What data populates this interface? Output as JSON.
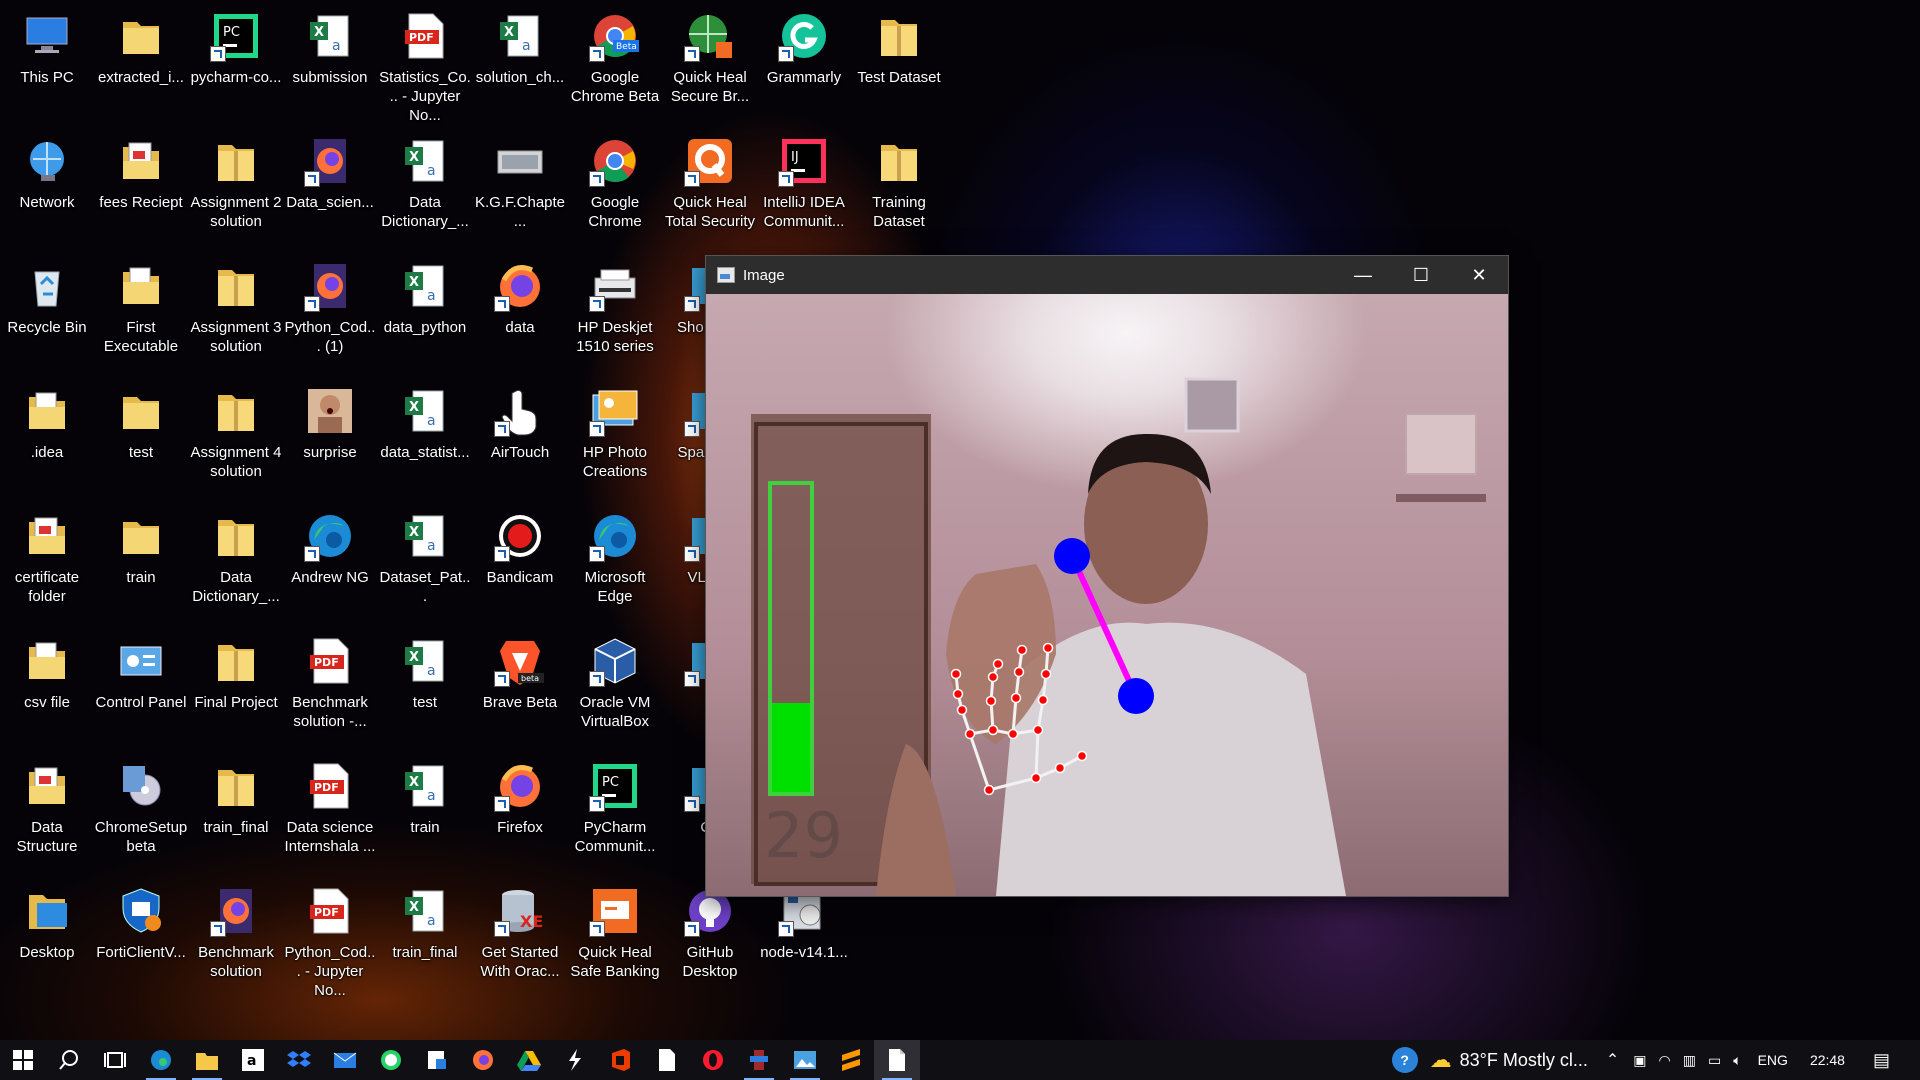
{
  "desktop": {
    "icons": [
      {
        "label": "This PC",
        "type": "pc"
      },
      {
        "label": "Network",
        "type": "network"
      },
      {
        "label": "Recycle Bin",
        "type": "recycle"
      },
      {
        "label": ".idea",
        "type": "folder-file"
      },
      {
        "label": "certificate folder",
        "type": "folder-pdf"
      },
      {
        "label": "csv file",
        "type": "folder-file"
      },
      {
        "label": "Data Structure",
        "type": "folder-pdf"
      },
      {
        "label": "Desktop",
        "type": "folder-blue"
      },
      {
        "label": "extracted_i...",
        "type": "folder"
      },
      {
        "label": "fees Reciept",
        "type": "folder-pdf"
      },
      {
        "label": "First Executable",
        "type": "folder-file"
      },
      {
        "label": "test",
        "type": "folder"
      },
      {
        "label": "train",
        "type": "folder"
      },
      {
        "label": "Control Panel",
        "type": "control"
      },
      {
        "label": "ChromeSetup beta",
        "type": "setup"
      },
      {
        "label": "FortiClientV...",
        "type": "shield"
      },
      {
        "label": "pycharm-co...",
        "type": "pycharm"
      },
      {
        "label": "Assignment 2 solution",
        "type": "zip"
      },
      {
        "label": "Assignment 3 solution",
        "type": "zip"
      },
      {
        "label": "Assignment 4 solution",
        "type": "zip"
      },
      {
        "label": "Data Dictionary_...",
        "type": "zip"
      },
      {
        "label": "Final Project",
        "type": "zip"
      },
      {
        "label": "train_final",
        "type": "zip"
      },
      {
        "label": "Benchmark solution",
        "type": "firefox-doc"
      },
      {
        "label": "submission",
        "type": "excel"
      },
      {
        "label": "Data_scien...",
        "type": "firefox-doc"
      },
      {
        "label": "Python_Cod... (1)",
        "type": "firefox-doc"
      },
      {
        "label": "surprise",
        "type": "photo"
      },
      {
        "label": "Andrew NG",
        "type": "edge"
      },
      {
        "label": "Benchmark solution -...",
        "type": "pdf"
      },
      {
        "label": "Data science Internshala ...",
        "type": "pdf"
      },
      {
        "label": "Python_Cod... - Jupyter No...",
        "type": "pdf"
      },
      {
        "label": "Statistics_Co... - Jupyter No...",
        "type": "pdf"
      },
      {
        "label": "Data Dictionary_...",
        "type": "excel"
      },
      {
        "label": "data_python",
        "type": "excel"
      },
      {
        "label": "data_statist...",
        "type": "excel"
      },
      {
        "label": "Dataset_Pat...",
        "type": "excel"
      },
      {
        "label": "test",
        "type": "excel"
      },
      {
        "label": "train",
        "type": "excel"
      },
      {
        "label": "train_final",
        "type": "excel"
      },
      {
        "label": "solution_ch...",
        "type": "excel"
      },
      {
        "label": "K.G.F.Chapte...",
        "type": "video"
      },
      {
        "label": "data",
        "type": "firefox"
      },
      {
        "label": "AirTouch",
        "type": "hand"
      },
      {
        "label": "Bandicam",
        "type": "record"
      },
      {
        "label": "Brave Beta",
        "type": "brave"
      },
      {
        "label": "Firefox",
        "type": "firefox"
      },
      {
        "label": "Get Started With Orac...",
        "type": "oracle-db"
      },
      {
        "label": "Google Chrome Beta",
        "type": "chrome-beta"
      },
      {
        "label": "Google Chrome",
        "type": "chrome"
      },
      {
        "label": "HP Deskjet 1510 series",
        "type": "printer"
      },
      {
        "label": "HP Photo Creations",
        "type": "hp-photo"
      },
      {
        "label": "Microsoft Edge",
        "type": "edge"
      },
      {
        "label": "Oracle VM VirtualBox",
        "type": "vbox"
      },
      {
        "label": "PyCharm Communit...",
        "type": "pycharm"
      },
      {
        "label": "Quick Heal Safe Banking",
        "type": "qh-bank"
      },
      {
        "label": "Quick Heal Secure Br...",
        "type": "qh-globe"
      },
      {
        "label": "Quick Heal Total Security",
        "type": "qh"
      },
      {
        "label": "Sho Supp",
        "type": "generic"
      },
      {
        "label": "Spa Studi",
        "type": "generic"
      },
      {
        "label": "VLC pl",
        "type": "generic"
      },
      {
        "label": "B",
        "type": "generic"
      },
      {
        "label": "Ca",
        "type": "generic"
      },
      {
        "label": "GitHub Desktop",
        "type": "github"
      },
      {
        "label": "Grammarly",
        "type": "grammarly"
      },
      {
        "label": "IntelliJ IDEA Communit...",
        "type": "intellij"
      },
      {
        "label": "node-v14.1...",
        "type": "installer"
      },
      {
        "label": "Test Dataset",
        "type": "zip"
      },
      {
        "label": "Training Dataset",
        "type": "zip"
      }
    ]
  },
  "window": {
    "title": "Image",
    "minimize": "—",
    "maximize": "☐",
    "close": "✕",
    "volume_level": 0.29,
    "volume_text": "29",
    "line_color": "#ff00ff",
    "tip_color": "#0000ff",
    "landmark_color": "#ff0000"
  },
  "taskbar": {
    "weather": "83°F  Mostly cl...",
    "language": "ENG",
    "time": "22:48",
    "apps": [
      "start",
      "search",
      "taskview",
      "edge",
      "explorer",
      "amazon",
      "dropbox",
      "mail",
      "whatsapp",
      "notes",
      "firefox",
      "drive",
      "tool",
      "office",
      "files",
      "opera",
      "wings",
      "photos",
      "sublime",
      "notepad"
    ]
  }
}
